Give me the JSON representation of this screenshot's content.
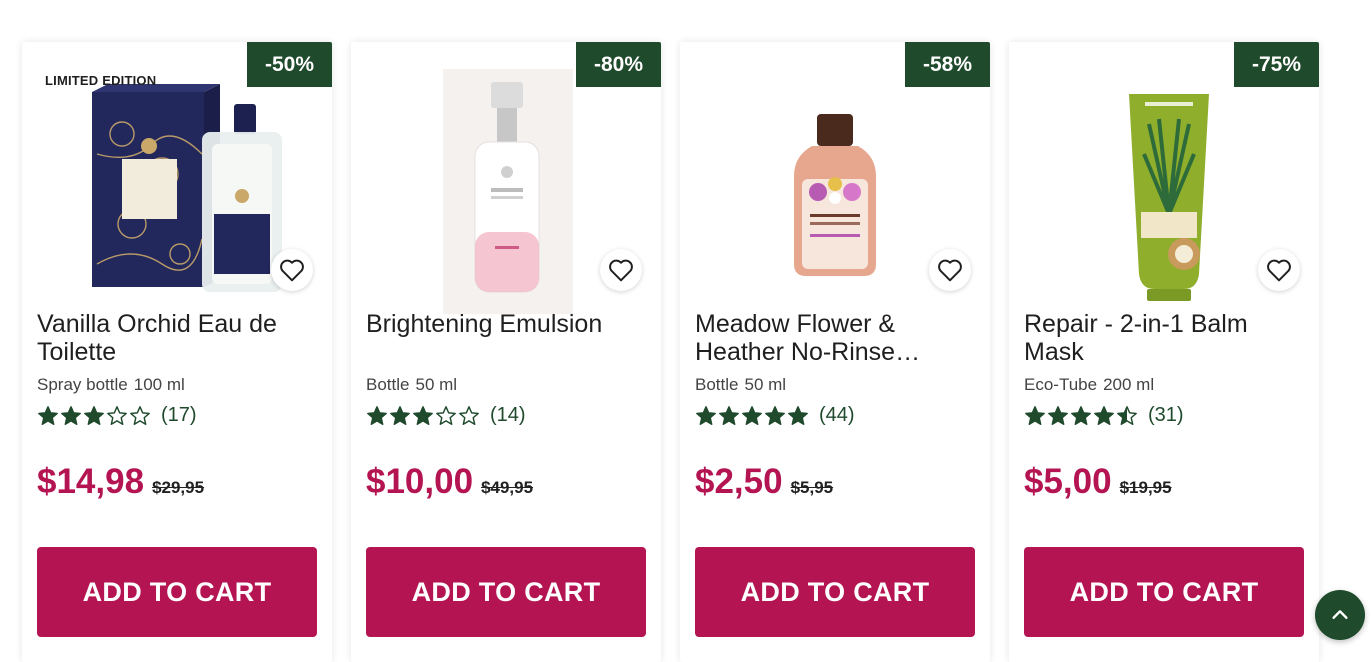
{
  "colors": {
    "accent": "#b41451",
    "badge": "#1f4a2c",
    "star": "#1f4a2c"
  },
  "cart_label": "ADD TO CART",
  "products": [
    {
      "badge_text": "LIMITED EDITION",
      "discount": "-50%",
      "name": "Vanilla Orchid Eau de Toilette",
      "container": "Spray bottle",
      "volume": "100 ml",
      "rating": 3,
      "rating_count": "(17)",
      "price": "$14,98",
      "old_price": "$29,95",
      "image_icon": "perfume-bottle-icon"
    },
    {
      "badge_text": "",
      "discount": "-80%",
      "name": "Brightening Emulsion",
      "container": "Bottle",
      "volume": "50 ml",
      "rating": 3,
      "rating_count": "(14)",
      "price": "$10,00",
      "old_price": "$49,95",
      "image_icon": "pump-bottle-icon"
    },
    {
      "badge_text": "",
      "discount": "-58%",
      "name": "Meadow Flower & Heather No-Rinse Cleansing Gel",
      "container": "Bottle",
      "volume": "50 ml",
      "rating": 5,
      "rating_count": "(44)",
      "price": "$2,50",
      "old_price": "$5,95",
      "image_icon": "small-bottle-icon"
    },
    {
      "badge_text": "",
      "discount": "-75%",
      "name": "Repair - 2-in-1 Balm Mask",
      "container": "Eco-Tube",
      "volume": "200 ml",
      "rating": 4.5,
      "rating_count": "(31)",
      "price": "$5,00",
      "old_price": "$19,95",
      "image_icon": "tube-icon"
    }
  ],
  "scroll_top_icon": "chevron-up-icon"
}
